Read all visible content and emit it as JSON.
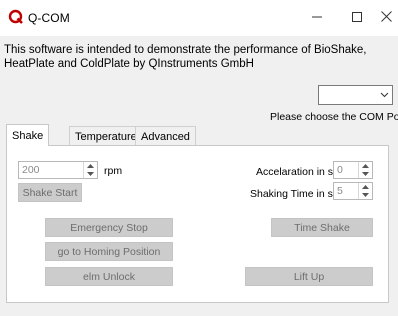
{
  "window": {
    "title": "Q-COM",
    "brand_color": "#c00000",
    "icons": {
      "app": "q-logo-icon",
      "minimize": "minimize-icon",
      "maximize": "maximize-icon",
      "close": "close-icon"
    }
  },
  "intro": {
    "text": "This software is intended to demonstrate the performance of BioShake, HeatPlate and ColdPlate by QInstruments GmbH"
  },
  "com_port": {
    "selected": "",
    "hint": "Please choose the COM Port"
  },
  "tabs": [
    {
      "label": "Shake",
      "active": true
    },
    {
      "label": "Temperature",
      "active": false
    },
    {
      "label": "Advanced",
      "active": false
    }
  ],
  "shake": {
    "rpm_value": "200",
    "rpm_unit": "rpm",
    "acceleration_label": "Accelaration in s",
    "acceleration_value": "0",
    "shaking_time_label": "Shaking Time in s",
    "shaking_time_value": "5",
    "buttons": {
      "shake_start": "Shake Start",
      "emergency_stop": "Emergency Stop",
      "time_shake": "Time Shake",
      "homing": "go to Homing Position",
      "elm_unlock": "elm Unlock",
      "lift_up": "Lift Up"
    }
  }
}
